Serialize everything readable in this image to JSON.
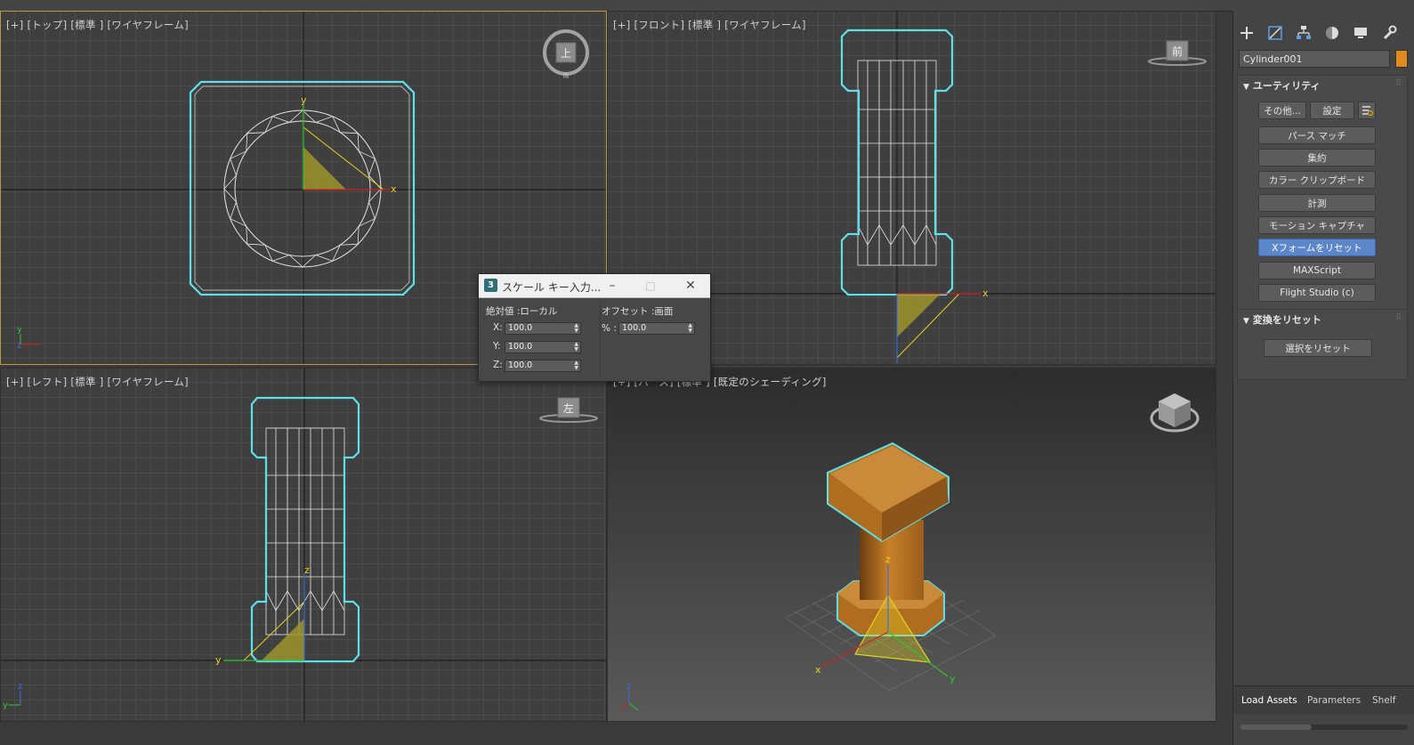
{
  "viewports": {
    "top": {
      "label": "[+] [トップ] [標準 ] [ワイヤフレーム]",
      "cube_label": "上",
      "cube_south": "南"
    },
    "front": {
      "label": "[+] [フロント] [標準 ] [ワイヤフレーム]",
      "cube_label": "前"
    },
    "left": {
      "label": "[+] [レフト] [標準 ] [ワイヤフレーム]",
      "cube_label": "左"
    },
    "persp": {
      "label": "[+] [パース] [標準 ] [既定のシェーディング]"
    }
  },
  "axes": {
    "x": "x",
    "y": "y",
    "z": "z"
  },
  "command_panel": {
    "tab_icons": [
      "create-icon",
      "modify-icon",
      "hierarchy-icon",
      "motion-icon",
      "display-icon",
      "utilities-icon"
    ],
    "object_name": "Cylinder001",
    "object_color": "#e08a1e",
    "utilities": {
      "title": "ユーティリティ",
      "more_button": "その他...",
      "sets_button": "設定",
      "buttons": [
        "パース マッチ",
        "集約",
        "カラー クリップボード",
        "計測",
        "モーション キャプチャ",
        "Xフォームをリセット",
        "MAXScript",
        "Flight Studio (c)"
      ],
      "active": "Xフォームをリセット"
    },
    "reset_transform": {
      "title": "変換をリセット",
      "button": "選択をリセット"
    },
    "bottom_tabs": [
      "Load Assets",
      "Parameters",
      "Shelf"
    ]
  },
  "dialog": {
    "title": "スケール キー入力...",
    "absolute_label": "絶対値 :ローカル",
    "offset_label": "オフセット :画面",
    "x_label": "X:",
    "x_value": "100.0",
    "y_label": "Y:",
    "y_value": "100.0",
    "z_label": "Z:",
    "z_value": "100.0",
    "percent_label": "% :",
    "percent_value": "100.0"
  },
  "colors": {
    "selection": "#5fe0e8",
    "gizmo": "#e6d21e",
    "object": "#c97a22",
    "viewport_active_border": "#b99b3a"
  }
}
